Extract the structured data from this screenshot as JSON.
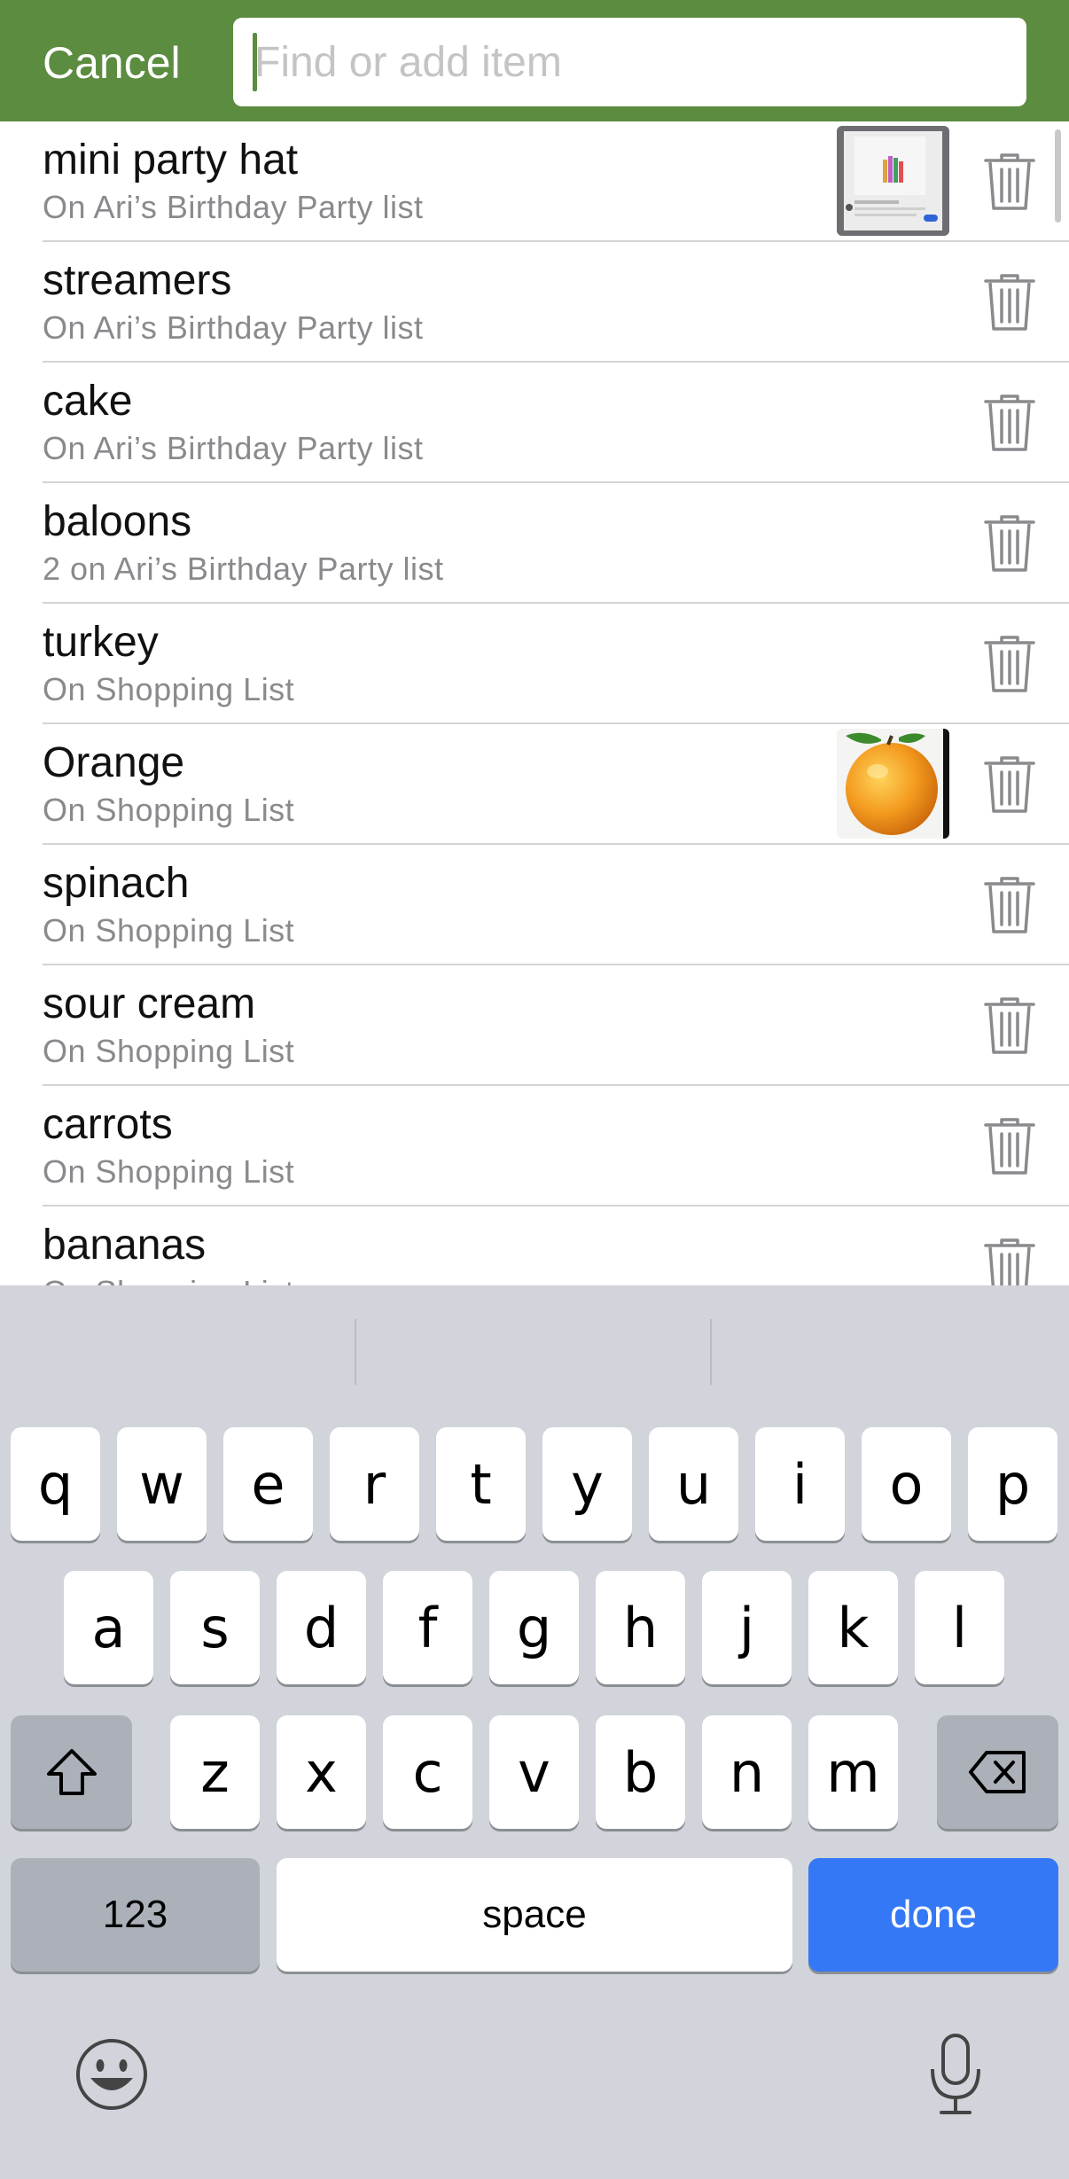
{
  "header": {
    "cancel_label": "Cancel",
    "search_placeholder": "Find or add item",
    "search_value": ""
  },
  "items": [
    {
      "name": "mini party hat",
      "sub": "On Ari’s Birthday Party list",
      "has_photo": true
    },
    {
      "name": "streamers",
      "sub": "On Ari’s Birthday Party list",
      "has_photo": false
    },
    {
      "name": "cake",
      "sub": "On Ari’s Birthday Party list",
      "has_photo": false
    },
    {
      "name": "baloons",
      "sub": "2 on Ari’s Birthday Party list",
      "has_photo": false
    },
    {
      "name": "turkey",
      "sub": "On Shopping List",
      "has_photo": false
    },
    {
      "name": "Orange",
      "sub": "On Shopping List",
      "has_photo": true
    },
    {
      "name": "spinach",
      "sub": "On Shopping List",
      "has_photo": false
    },
    {
      "name": "sour cream",
      "sub": "On Shopping List",
      "has_photo": false
    },
    {
      "name": "carrots",
      "sub": "On Shopping List",
      "has_photo": false
    },
    {
      "name": "bananas",
      "sub": "On Shopping List",
      "has_photo": false
    }
  ],
  "keyboard": {
    "row1": [
      "q",
      "w",
      "e",
      "r",
      "t",
      "y",
      "u",
      "i",
      "o",
      "p"
    ],
    "row2": [
      "a",
      "s",
      "d",
      "f",
      "g",
      "h",
      "j",
      "k",
      "l"
    ],
    "row3": [
      "z",
      "x",
      "c",
      "v",
      "b",
      "n",
      "m"
    ],
    "numbers_label": "123",
    "space_label": "space",
    "done_label": "done",
    "shift_icon": "shift-icon",
    "delete_icon": "delete-icon",
    "emoji_icon": "emoji-icon",
    "mic_icon": "microphone-icon"
  },
  "colors": {
    "header_green": "#5b8c3f",
    "done_blue": "#3478f6",
    "keyboard_bg": "#d1d4da"
  }
}
